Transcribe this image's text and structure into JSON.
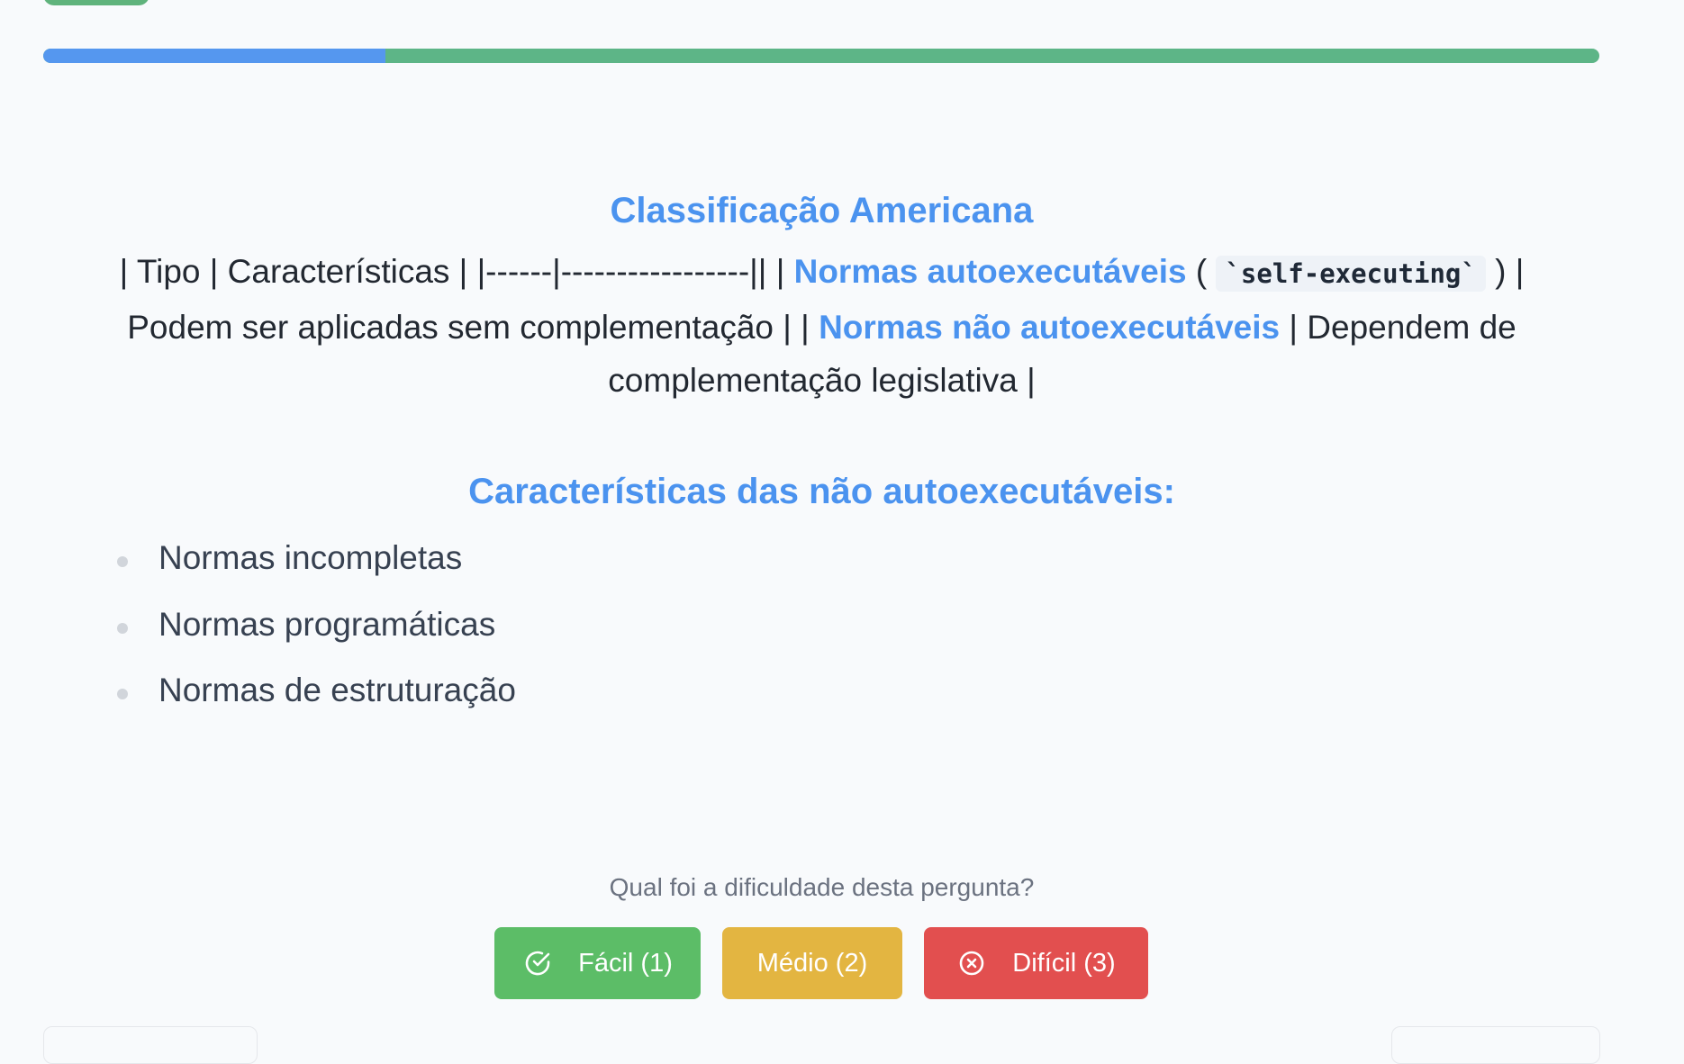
{
  "progress": {
    "fraction": 0.22,
    "fill_color": "#5597ef",
    "track_color": "#5db587"
  },
  "section1": {
    "heading": "Classificação Americana",
    "table_row_start": "| Tipo | Características | |------|-----------------|| | ",
    "self_label": "Normas autoexecutáveis",
    "open_paren": " ( ",
    "self_code": "`self-executing`",
    "self_description": " ) | Podem ser aplicadas sem complementação | | ",
    "nonself_label": "Normas não autoexecutáveis",
    "nonself_description": " | Dependem de complementação legislativa |"
  },
  "section2": {
    "heading": "Características das não autoexecutáveis:",
    "items": [
      "Normas incompletas",
      "Normas programáticas",
      "Normas de estruturação"
    ]
  },
  "difficulty": {
    "prompt": "Qual foi a dificuldade desta pergunta?",
    "easy_label": "Fácil (1)",
    "easy_icon": "check-circle-icon",
    "medium_label": "Médio (2)",
    "hard_label": "Difícil (3)",
    "hard_icon": "x-circle-icon",
    "easy_color": "#5cbd67",
    "medium_color": "#e3b541",
    "hard_color": "#e24f4f"
  }
}
